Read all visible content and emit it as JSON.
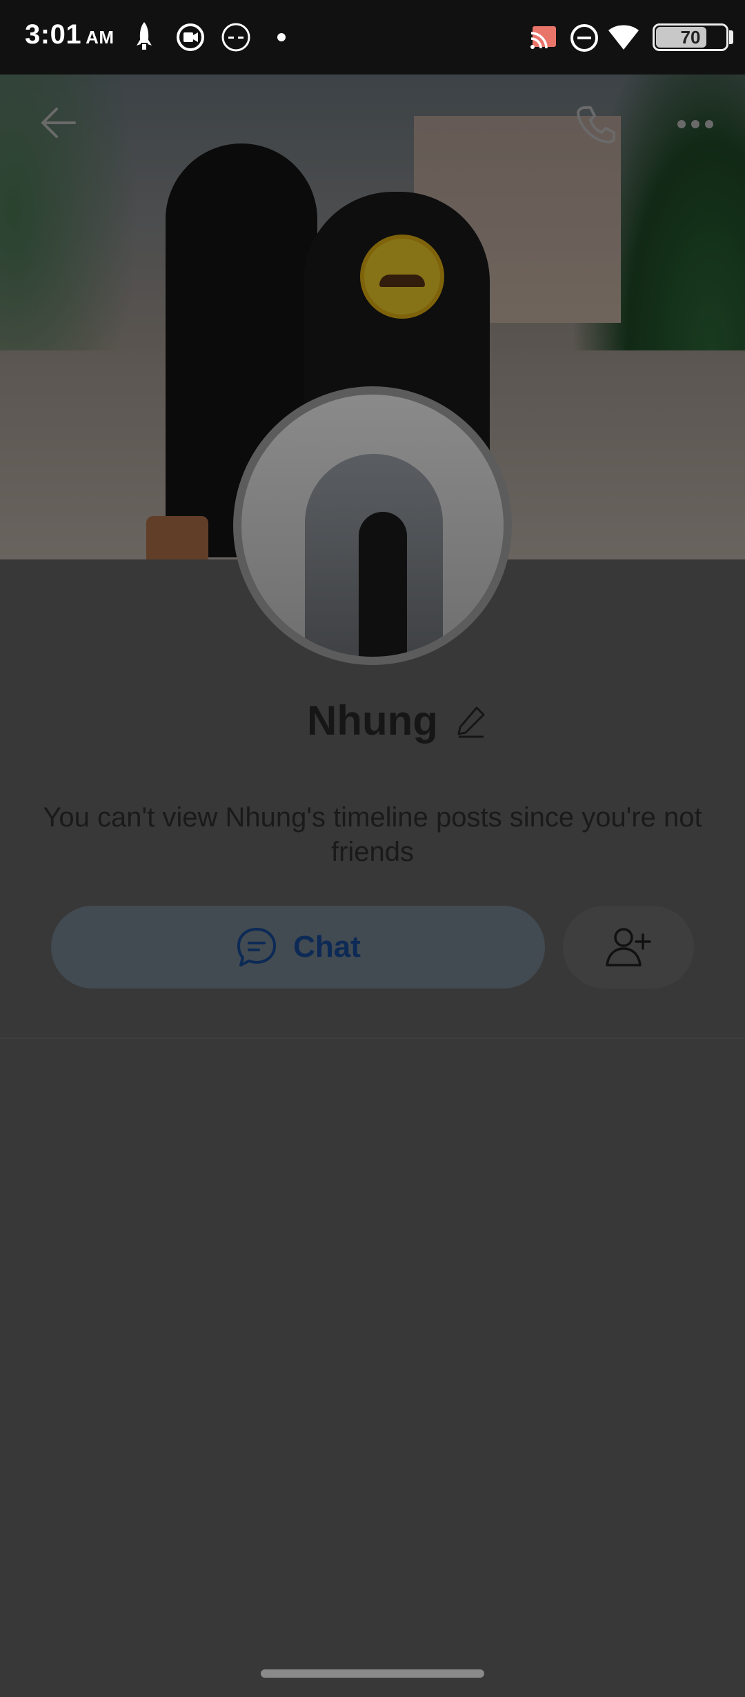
{
  "status_bar": {
    "time": "3:01",
    "ampm": "AM",
    "battery": "70",
    "icons": [
      "rocket-icon",
      "screen-record-icon",
      "dash-circle-icon",
      "dot-icon",
      "cast-icon",
      "do-not-disturb-icon",
      "wifi-icon",
      "battery-icon"
    ]
  },
  "top_nav": {
    "icons": [
      "back-arrow-icon",
      "phone-call-icon",
      "more-dots-icon"
    ]
  },
  "profile": {
    "name": "Nhung",
    "notice": "You can't view Nhung's timeline posts since you're not friends"
  },
  "actions": {
    "chat_label": "Chat",
    "icons": [
      "chat-bubble-icon",
      "add-friend-icon",
      "edit-pencil-icon"
    ]
  }
}
